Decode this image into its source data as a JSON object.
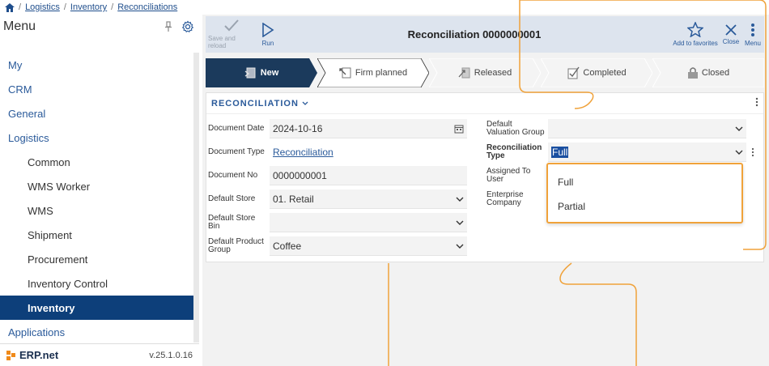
{
  "breadcrumb": {
    "items": [
      "Logistics",
      "Inventory",
      "Reconciliations"
    ]
  },
  "sidebar": {
    "title": "Menu",
    "items": [
      {
        "label": "My",
        "level": 1
      },
      {
        "label": "CRM",
        "level": 1
      },
      {
        "label": "General",
        "level": 1
      },
      {
        "label": "Logistics",
        "level": 1
      },
      {
        "label": "Common",
        "level": 2
      },
      {
        "label": "WMS Worker",
        "level": 2
      },
      {
        "label": "WMS",
        "level": 2
      },
      {
        "label": "Shipment",
        "level": 2
      },
      {
        "label": "Procurement",
        "level": 2
      },
      {
        "label": "Inventory Control",
        "level": 2
      },
      {
        "label": "Inventory",
        "level": 2,
        "active": true
      },
      {
        "label": "Applications",
        "level": 1
      }
    ],
    "footer": {
      "logo_text": "ERP.net",
      "version": "v.25.1.0.16"
    }
  },
  "toolbar": {
    "save_reload_label": "Save and reload",
    "run_label": "Run",
    "title": "Reconciliation 0000000001",
    "favorites_label": "Add to favorites",
    "close_label": "Close",
    "menu_label": "Menu"
  },
  "steps": [
    {
      "label": "New",
      "active": true
    },
    {
      "label": "Firm planned"
    },
    {
      "label": "Released"
    },
    {
      "label": "Completed"
    },
    {
      "label": "Closed"
    }
  ],
  "panel": {
    "title": "RECONCILIATION",
    "left_fields": {
      "document_date": {
        "label": "Document Date",
        "value": "2024-10-16"
      },
      "document_type": {
        "label": "Document Type",
        "value": "Reconciliation"
      },
      "document_no": {
        "label": "Document No",
        "value": "0000000001"
      },
      "default_store": {
        "label": "Default Store",
        "value": "01. Retail"
      },
      "default_store_bin": {
        "label_line1": "Default Store",
        "label_line2": "Bin",
        "value": ""
      },
      "default_product_group": {
        "label_line1": "Default Product",
        "label_line2": "Group",
        "value": "Coffee"
      }
    },
    "right_fields": {
      "default_valuation_group": {
        "label_line1": "Default",
        "label_line2": "Valuation Group",
        "value": ""
      },
      "reconciliation_type": {
        "label_line1": "Reconciliation",
        "label_line2": "Type",
        "value": "Full"
      },
      "assigned_to_user": {
        "label_line1": "Assigned To",
        "label_line2": "User"
      },
      "enterprise_company": {
        "label_line1": "Enterprise",
        "label_line2": "Company"
      }
    },
    "dropdown_options": [
      "Full",
      "Partial"
    ]
  },
  "colors": {
    "accent": "#0d3f7a",
    "step_active": "#1b3a5c",
    "highlight_border": "#f0a23a",
    "link": "#2a5a9a"
  }
}
